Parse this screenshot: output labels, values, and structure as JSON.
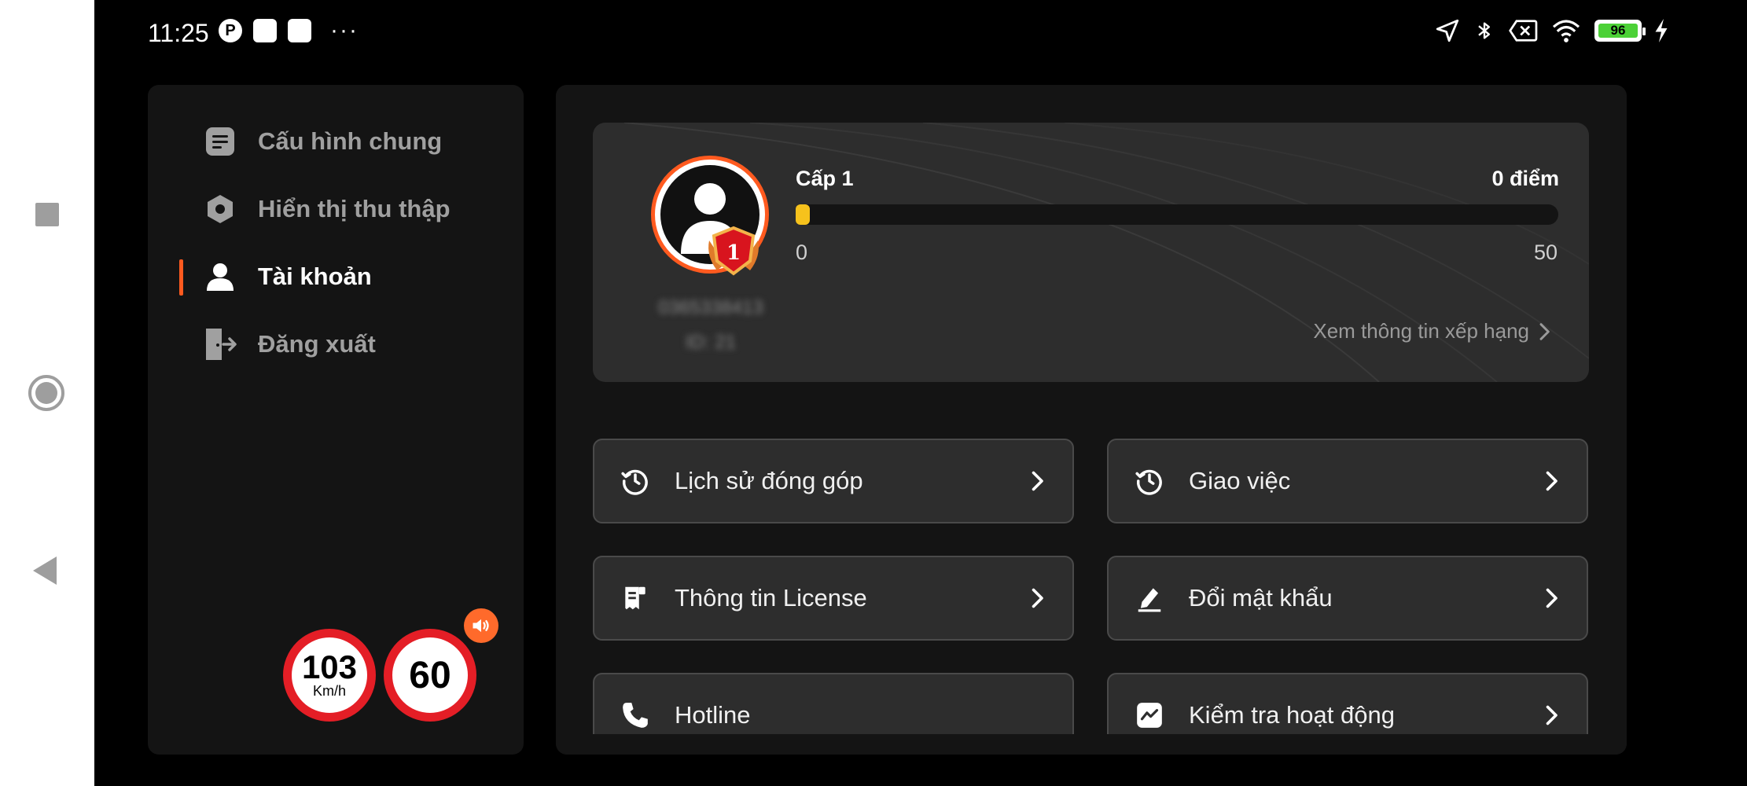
{
  "status_bar": {
    "time": "11:25",
    "battery_level": "96"
  },
  "sidebar": {
    "items": [
      {
        "label": "Cấu hình chung",
        "icon": "list-doc-icon"
      },
      {
        "label": "Hiển thị thu thập",
        "icon": "hexagon-icon"
      },
      {
        "label": "Tài khoản",
        "icon": "user-icon",
        "active": true
      },
      {
        "label": "Đăng xuất",
        "icon": "logout-icon"
      }
    ]
  },
  "speed": {
    "current": "103",
    "unit": "Km/h",
    "limit": "60"
  },
  "profile": {
    "rank_number": "1",
    "phone": "0365338413",
    "id": "ID: 21",
    "level": "Cấp 1",
    "points": "0 điểm",
    "progress_min": "0",
    "progress_max": "50",
    "progress_fraction": 0.0,
    "rank_link": "Xem thông tin xếp hạng"
  },
  "actions": [
    {
      "label": "Lịch sử đóng góp",
      "icon": "history-icon"
    },
    {
      "label": "Giao việc",
      "icon": "history-icon"
    },
    {
      "label": "Thông tin License",
      "icon": "license-icon"
    },
    {
      "label": "Đổi mật khẩu",
      "icon": "edit-icon"
    },
    {
      "label": "Hotline",
      "icon": "phone-icon"
    },
    {
      "label": "Kiểm tra hoạt động",
      "icon": "activity-icon"
    }
  ],
  "colors": {
    "accent": "#ff5a1f",
    "progress": "#f6c21c",
    "speed_ring": "#e41e26"
  }
}
